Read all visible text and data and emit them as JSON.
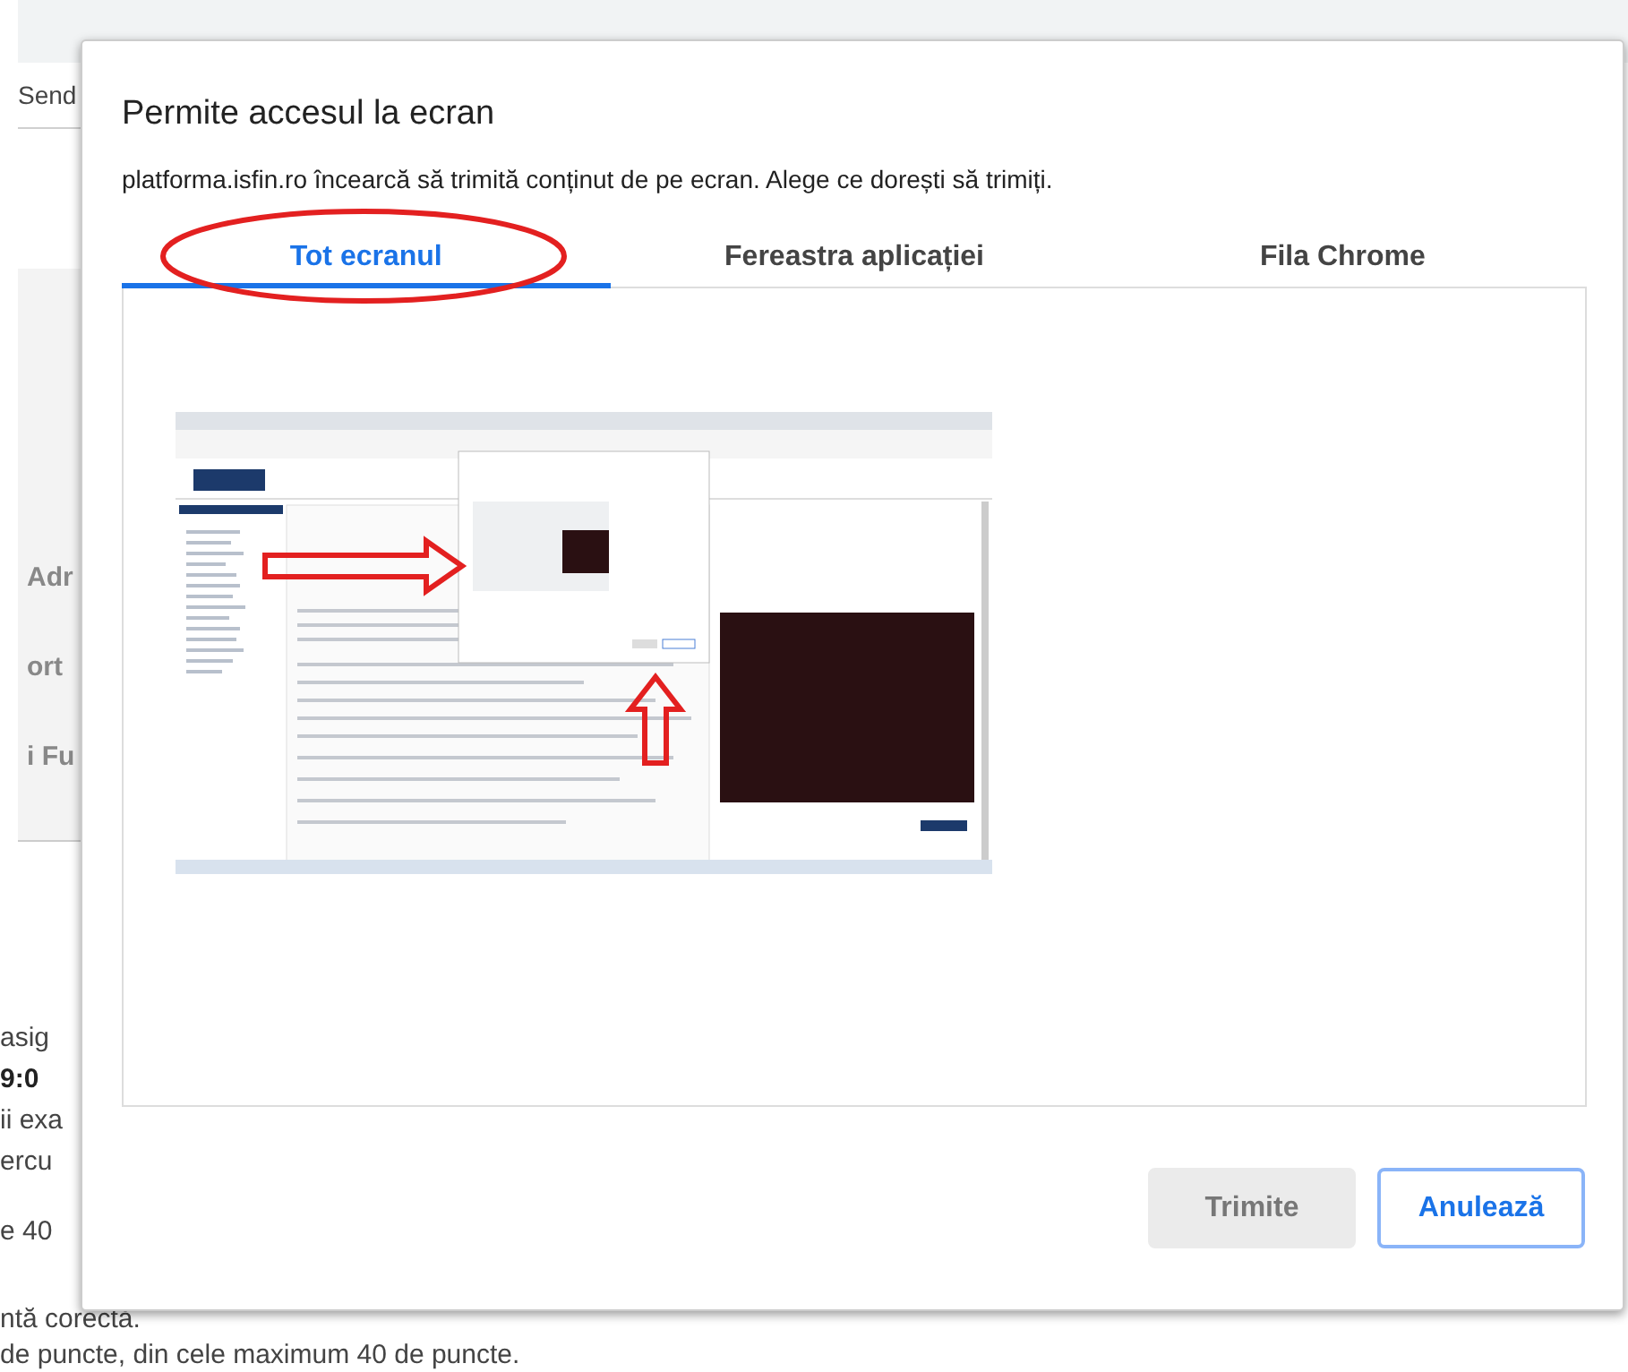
{
  "background_page": {
    "header_text": "Send",
    "side_items": [
      "Adr",
      "ort",
      "i Fu"
    ],
    "body_lines": [
      {
        "text": "asig",
        "bold": false
      },
      {
        "text": "9:0",
        "bold": true
      },
      {
        "text": "ii exa",
        "bold": false
      },
      {
        "text": "ercu",
        "bold": false
      },
      {
        "text": "e 40",
        "bold": false
      }
    ],
    "footer_lines": [
      "ntă corectă.",
      "de puncte, din cele maximum 40 de puncte."
    ]
  },
  "dialog": {
    "title": "Permite accesul la ecran",
    "message": "platforma.isfin.ro încearcă să trimită conținut de pe ecran. Alege ce dorești să trimiți.",
    "tabs": [
      {
        "label": "Tot ecranul",
        "selected": true,
        "circled": true
      },
      {
        "label": "Fereastra aplicației",
        "selected": false,
        "circled": false
      },
      {
        "label": "Fila Chrome",
        "selected": false,
        "circled": false
      }
    ],
    "buttons": [
      {
        "label": "Trimite",
        "kind": "primary",
        "disabled": true
      },
      {
        "label": "Anulează",
        "kind": "cancel",
        "disabled": false
      }
    ]
  }
}
